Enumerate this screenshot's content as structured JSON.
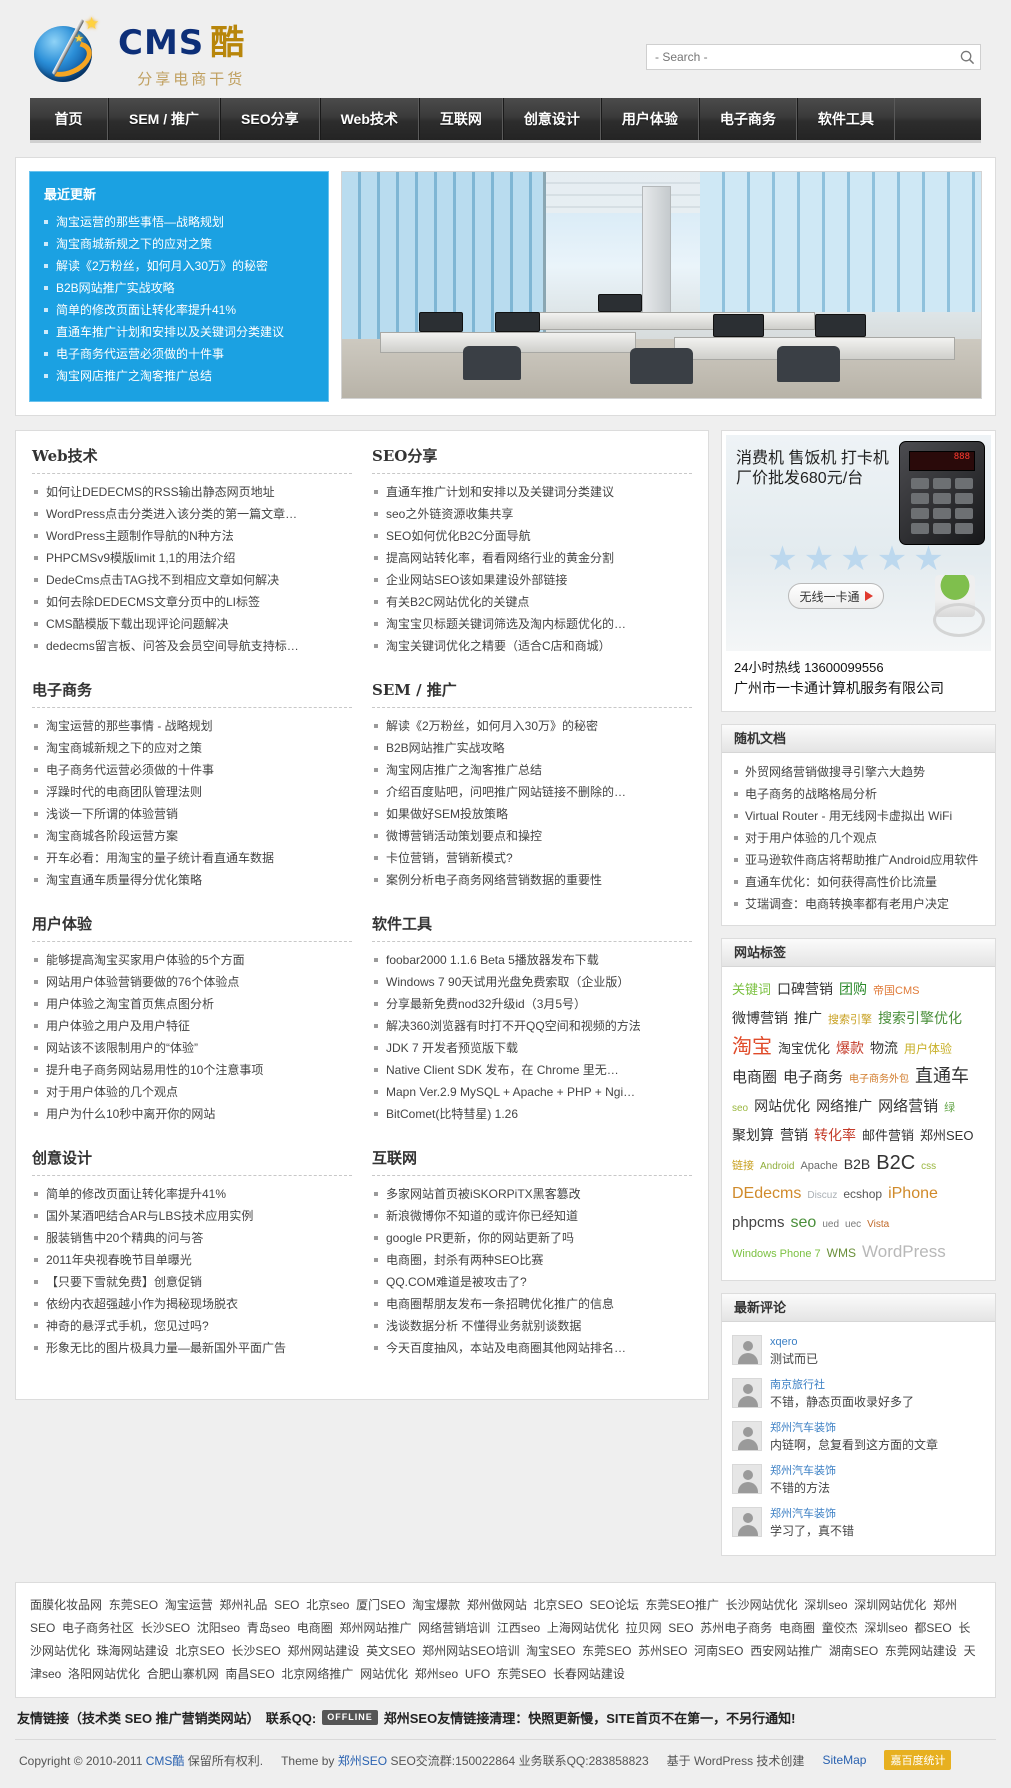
{
  "site": {
    "logo_cms": "CMS",
    "logo_ku": "酷",
    "logo_sub": "分享电商干货"
  },
  "search": {
    "placeholder": "- Search -",
    "value": ""
  },
  "nav": [
    "首页",
    "SEM / 推广",
    "SEO分享",
    "Web技术",
    "互联网",
    "创意设计",
    "用户体验",
    "电子商务",
    "软件工具"
  ],
  "recent": {
    "title": "最近更新",
    "items": [
      "淘宝运营的那些事悟—战略规划",
      "淘宝商城新规之下的应对之策",
      "解读《2万粉丝，如何月入30万》的秘密",
      "B2B网站推广实战攻略",
      "简单的修改页面让转化率提升41%",
      "直通车推广计划和安排以及关键词分类建议",
      "电子商务代运营必须做的十件事",
      "淘宝网店推广之淘客推广总结"
    ]
  },
  "categories_left": [
    {
      "title": "Web技术",
      "items": [
        "如何让DEDECMS的RSS输出静态网页地址",
        "WordPress点击分类进入该分类的第一篇文章…",
        "WordPress主题制作导航的N种方法",
        "PHPCMSv9模版limit 1,1的用法介绍",
        "DedeCms点击TAG找不到相应文章如何解决",
        "如何去除DEDECMS文章分页中的LI标签",
        "CMS酷模版下载出现评论问题解决",
        "dedecms留言板、问答及会员空间导航支持标…"
      ]
    },
    {
      "title": "电子商务",
      "items": [
        "淘宝运营的那些事情 - 战略规划",
        "淘宝商城新规之下的应对之策",
        "电子商务代运营必须做的十件事",
        "浮躁时代的电商团队管理法则",
        "浅谈一下所谓的体验营销",
        "淘宝商城各阶段运营方案",
        "开车必看：用淘宝的量子统计看直通车数据",
        "淘宝直通车质量得分优化策略"
      ]
    },
    {
      "title": "用户体验",
      "items": [
        "能够提高淘宝买家用户体验的5个方面",
        "网站用户体验营销要做的76个体验点",
        "用户体验之淘宝首页焦点图分析",
        "用户体验之用户及用户特征",
        "网站该不该限制用户的“体验”",
        "提升电子商务网站易用性的10个注意事项",
        "对于用户体验的几个观点",
        "用户为什么10秒中离开你的网站"
      ]
    },
    {
      "title": "创意设计",
      "items": [
        "简单的修改页面让转化率提升41%",
        "国外某酒吧结合AR与LBS技术应用实例",
        "服装销售中20个精典的问与答",
        "2011年央视春晚节目单曝光",
        "【只要下雪就免费】创意促销",
        "依纷内衣超强越小作为揭秘现场脱衣",
        "神奇的悬浮式手机，您见过吗?",
        "形象无比的图片极具力量—最新国外平面广告"
      ]
    }
  ],
  "categories_right": [
    {
      "title": "SEO分享",
      "items": [
        "直通车推广计划和安排以及关键词分类建议",
        "seo之外链资源收集共享",
        "SEO如何优化B2C分面导航",
        "提高网站转化率，看看网络行业的黄金分割",
        "企业网站SEO该如果建设外部链接",
        "有关B2C网站优化的关键点",
        "淘宝宝贝标题关键词筛选及淘内标题优化的…",
        "淘宝关键词优化之精要（适合C店和商城）"
      ]
    },
    {
      "title": "SEM / 推广",
      "items": [
        "解读《2万粉丝，如何月入30万》的秘密",
        "B2B网站推广实战攻略",
        "淘宝网店推广之淘客推广总结",
        "介绍百度贴吧，问吧推广网站链接不删除的…",
        "如果做好SEM投放策略",
        "微博营销活动策划要点和操控",
        "卡位营销，营销新模式?",
        "案例分析电子商务网络营销数据的重要性"
      ]
    },
    {
      "title": "软件工具",
      "items": [
        "foobar2000 1.1.6 Beta 5播放器发布下载",
        "Windows 7 90天试用光盘免费索取（企业版）",
        "分享最新免费nod32升级id（3月5号）",
        "解决360浏览器有时打不开QQ空间和视频的方法",
        "JDK 7 开发者预览版下载",
        "Native Client SDK 发布，在 Chrome 里无…",
        "Mapn Ver.2.9 MySQL + Apache + PHP + Ngi…",
        "BitComet(比特彗星) 1.26"
      ]
    },
    {
      "title": "互联网",
      "items": [
        "多家网站首页被iSKORPiTX黑客篡改",
        "新浪微博你不知道的或许你已经知道",
        "google PR更新，你的网站更新了吗",
        "电商圈，封杀有两种SEO比赛",
        "QQ.COM难道是被攻击了?",
        "电商圈帮朋友发布一条招聘优化推广的信息",
        "浅谈数据分析 不懂得业务就别谈数据",
        "今天百度抽风，本站及电商圈其他网站排名…"
      ]
    }
  ],
  "ad": {
    "line1": "消费机 售饭机 打卡机",
    "line2": "厂价批发680元/台",
    "button": "无线一卡通",
    "hotline": "24小时热线  13600099556",
    "company": "广州市一卡通计算机服务有限公司",
    "screen_text": "888"
  },
  "random_docs": {
    "title": "随机文档",
    "items": [
      "外贸网络营销做搜寻引擎六大趋势",
      "电子商务的战略格局分析",
      "Virtual Router - 用无线网卡虚拟出 WiFi",
      "对于用户体验的几个观点",
      "亚马逊软件商店将帮助推广Android应用软件",
      "直通车优化：如何获得高性价比流量",
      "艾瑞调查：电商转换率都有老用户决定"
    ]
  },
  "tags": {
    "title": "网站标签",
    "items": [
      {
        "text": "关键词",
        "size": 13,
        "color": "#7cc142"
      },
      {
        "text": "口碑营销",
        "size": 14,
        "color": "#333333"
      },
      {
        "text": "团购",
        "size": 14,
        "color": "#2e8b2e"
      },
      {
        "text": "帝国CMS",
        "size": 11,
        "color": "#e07b39"
      },
      {
        "text": "微博营销",
        "size": 14,
        "color": "#333333"
      },
      {
        "text": "推广",
        "size": 14,
        "color": "#333333"
      },
      {
        "text": "搜索引擎",
        "size": 11,
        "color": "#c8a020"
      },
      {
        "text": "搜索引擎优化",
        "size": 14,
        "color": "#4a8f3a"
      },
      {
        "text": "淘宝",
        "size": 20,
        "color": "#e04b2a"
      },
      {
        "text": "淘宝优化",
        "size": 13,
        "color": "#333333"
      },
      {
        "text": "爆款",
        "size": 14,
        "color": "#c43b2a"
      },
      {
        "text": "物流",
        "size": 14,
        "color": "#333333"
      },
      {
        "text": "用户体验",
        "size": 12,
        "color": "#c8b028"
      },
      {
        "text": "电商圈",
        "size": 15,
        "color": "#333333"
      },
      {
        "text": "电子商务",
        "size": 15,
        "color": "#333333"
      },
      {
        "text": "电子商务外包",
        "size": 10,
        "color": "#d07a2a"
      },
      {
        "text": "直通车",
        "size": 18,
        "color": "#333333"
      },
      {
        "text": "seo",
        "size": 10,
        "color": "#9ab73f"
      },
      {
        "text": "网站优化",
        "size": 14,
        "color": "#333333"
      },
      {
        "text": "网络推广",
        "size": 14,
        "color": "#333333"
      },
      {
        "text": "网络营销",
        "size": 15,
        "color": "#333333"
      },
      {
        "text": "绿",
        "size": 11,
        "color": "#6aa84f"
      },
      {
        "text": "聚划算",
        "size": 14,
        "color": "#333333"
      },
      {
        "text": "营销",
        "size": 14,
        "color": "#333333"
      },
      {
        "text": "转化率",
        "size": 14,
        "color": "#c43b2a"
      },
      {
        "text": "邮件营销",
        "size": 13,
        "color": "#333333"
      },
      {
        "text": "郑州SEO",
        "size": 13,
        "color": "#333333"
      },
      {
        "text": "链接",
        "size": 11,
        "color": "#c8a020"
      },
      {
        "text": "Android",
        "size": 10,
        "color": "#8fae3a"
      },
      {
        "text": "Apache",
        "size": 11,
        "color": "#6a6a6a"
      },
      {
        "text": "B2B",
        "size": 14,
        "color": "#333333"
      },
      {
        "text": "B2C",
        "size": 20,
        "color": "#333333"
      },
      {
        "text": "css",
        "size": 10,
        "color": "#9ab73f"
      },
      {
        "text": "DEdecms",
        "size": 16,
        "color": "#d08a2a"
      },
      {
        "text": "Discuz",
        "size": 10,
        "color": "#aab0b5"
      },
      {
        "text": "ecshop",
        "size": 12,
        "color": "#555555"
      },
      {
        "text": "iPhone",
        "size": 16,
        "color": "#d08a2a"
      },
      {
        "text": "phpcms",
        "size": 15,
        "color": "#444444"
      },
      {
        "text": "seo",
        "size": 16,
        "color": "#4a8f3a"
      },
      {
        "text": "ued",
        "size": 10,
        "color": "#7a7a7a"
      },
      {
        "text": "uec",
        "size": 10,
        "color": "#7a7a7a"
      },
      {
        "text": "Vista",
        "size": 10,
        "color": "#c06a2a"
      },
      {
        "text": "Windows Phone 7",
        "size": 11,
        "color": "#7cc142"
      },
      {
        "text": "WMS",
        "size": 12,
        "color": "#6a8f3a"
      },
      {
        "text": "WordPress",
        "size": 17,
        "color": "#b8b8b8"
      }
    ]
  },
  "comments": {
    "title": "最新评论",
    "items": [
      {
        "author": "xqero",
        "text": "测试而已"
      },
      {
        "author": "南京旅行社",
        "text": "不错，静态页面收录好多了"
      },
      {
        "author": "郑州汽车装饰",
        "text": "内链啊，怠复看到这方面的文章"
      },
      {
        "author": "郑州汽车装饰",
        "text": "不错的方法"
      },
      {
        "author": "郑州汽车装饰",
        "text": "学习了，真不错"
      }
    ]
  },
  "footer": {
    "links": [
      "面膜化妆品网",
      "东莞SEO",
      "淘宝运营",
      "郑州礼品",
      "SEO",
      "北京seo",
      "厦门SEO",
      "淘宝爆款",
      "郑州做网站",
      "北京SEO",
      "SEO论坛",
      "东莞SEO推广",
      "长沙网站优化",
      "深圳seo",
      "深圳网站优化",
      "郑州SEO",
      "电子商务社区",
      "长沙SEO",
      "沈阳seo",
      "青岛seo",
      "电商圈",
      "郑州网站推广",
      "网络营销培训",
      "江西seo",
      "上海网站优化",
      "拉贝网",
      "SEO",
      "苏州电子商务",
      "电商圈",
      "童佼杰",
      "深圳seo",
      "都SEO",
      "长沙网站优化",
      "珠海网站建设",
      "北京SEO",
      "长沙SEO",
      "郑州网站建设",
      "英文SEO",
      "郑州网站SEO培训",
      "淘宝SEO",
      "东莞SEO",
      "苏州SEO",
      "河南SEO",
      "西安网站推广",
      "湖南SEO",
      "东莞网站建设",
      "天津seo",
      "洛阳网站优化",
      "合肥山寨机网",
      "南昌SEO",
      "北京网络推广",
      "网站优化",
      "郑州seo",
      "UFO",
      "东莞SEO",
      "长春网站建设"
    ],
    "friend_label": "友情链接（技术类 SEO 推广营销类网站）",
    "contact_label": "联系QQ:",
    "qq_badge": "OFFLINE",
    "friend_notice": "郑州SEO友情链接清理：快照更新慢，SITE首页不在第一，不另行通知!",
    "copyright": "Copyright © 2010-2011",
    "copyright_site": "CMS酷",
    "copyright_rights": "保留所有权利.",
    "theme_by": "Theme by",
    "theme_author": "郑州SEO",
    "seo_group": "SEO交流群:150022864",
    "biz_qq": "业务联系QQ:283858823",
    "powered": "基于 WordPress 技术创建",
    "sitemap": "SiteMap",
    "tongji": "嘉百度统计"
  }
}
